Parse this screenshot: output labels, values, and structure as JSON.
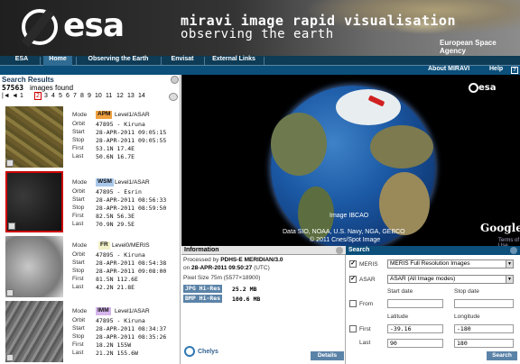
{
  "header": {
    "logo_text": "esa",
    "app_title": "miravi image rapid visualisation",
    "app_subtitle": "observing the earth",
    "agency": "European Space Agency"
  },
  "nav": {
    "items": [
      {
        "label": "ESA"
      },
      {
        "label": "Home"
      },
      {
        "label": "Observing the Earth"
      },
      {
        "label": "Envisat"
      },
      {
        "label": "External Links"
      }
    ],
    "active": "Home"
  },
  "subnav": {
    "about": "About MIRAVI",
    "help": "Help",
    "help_icon": "?"
  },
  "results": {
    "title": "Search Results",
    "count": "57563",
    "count_label": "images found",
    "pager": {
      "first": "|◄",
      "prev": "◄",
      "pages": [
        "1",
        "2",
        "3",
        "4",
        "5",
        "6",
        "7",
        "8",
        "9",
        "10",
        "11",
        "12",
        "13",
        "14"
      ],
      "current": "2"
    },
    "items": [
      {
        "mode_label": "Mode",
        "orbit_label": "Orbit",
        "start_label": "Start",
        "stop_label": "Stop",
        "first_label": "First",
        "last_label": "Last",
        "mode": "APM",
        "level": "Level1/ASAR",
        "orbit": "47895 - Kiruna",
        "start": "28-APR-2011 09:05:15",
        "stop": "28-APR-2011 09:05:55",
        "first": "53.1N 17.4E",
        "last": "50.6N 16.7E",
        "badge_color": "#f0a040",
        "thumb": "farm"
      },
      {
        "mode_label": "Mode",
        "orbit_label": "Orbit",
        "start_label": "Start",
        "stop_label": "Stop",
        "first_label": "First",
        "last_label": "Last",
        "mode": "WSM",
        "level": "Level1/ASAR",
        "orbit": "47895 - Esrin",
        "start": "28-APR-2011 08:56:33",
        "stop": "28-APR-2011 08:59:50",
        "first": "82.5N 56.3E",
        "last": "70.9N 29.5E",
        "badge_color": "#a9c8ec",
        "thumb": "dark"
      },
      {
        "mode_label": "Mode",
        "orbit_label": "Orbit",
        "start_label": "Start",
        "stop_label": "Stop",
        "first_label": "First",
        "last_label": "Last",
        "mode": "FR",
        "level": "Level0/MERIS",
        "orbit": "47895 - Kiruna",
        "start": "28-APR-2011 08:54:38",
        "stop": "28-APR-2011 09:08:00",
        "first": "81.5N 112.6E",
        "last": "42.2N 21.8E",
        "badge_color": "#f2f2c8",
        "thumb": "cloud"
      },
      {
        "mode_label": "Mode",
        "orbit_label": "Orbit",
        "start_label": "Start",
        "stop_label": "Stop",
        "first_label": "First",
        "last_label": "Last",
        "mode": "IMM",
        "level": "Level1/ASAR",
        "orbit": "47895 - Kiruna",
        "start": "28-APR-2011 08:34:37",
        "stop": "28-APR-2011 08:35:26",
        "first": "18.2N 155W",
        "last": "21.2N 155.6W",
        "badge_color": "#d6b6ec",
        "thumb": "grey"
      }
    ]
  },
  "globe": {
    "esa_logo": "esa",
    "image_credit": "Image IBCAO",
    "data_credit": "Data SIO, NOAA, U.S. Navy, NGA, GEBCO",
    "copyright": "© 2011 Cnes/Spot Image",
    "google": "Google",
    "terms": "Terms of Use"
  },
  "info": {
    "title": "Information",
    "processed_prefix": "Processed by",
    "processor": "PDHS-E MERIDIAN/3.0",
    "on_prefix": "on",
    "processed_date": "28-APR-2011 09:50:27",
    "processed_suffix": "(UTC)",
    "pixel_size": "Pixel Size 75m (5577×18900)",
    "jpg_label": "JPG Hi-Res",
    "jpg_size": "25.2 MB",
    "bmp_label": "BMP Hi-Res",
    "bmp_size": "100.6 MB",
    "logo": "Chelys",
    "details": "Details"
  },
  "search": {
    "title": "Search",
    "meris_label": "MERIS",
    "meris_value": "MERIS Full Resolution Images",
    "asar_label": "ASAR",
    "asar_value": "ASAR (All Image modes)",
    "start_date_label": "Start date",
    "stop_date_label": "Stop date",
    "from_label": "From",
    "latitude_label": "Latitude",
    "longitude_label": "Longitude",
    "first_label": "First",
    "last_label": "Last",
    "first_lat": "-39.16",
    "first_lon": "-180",
    "last_lat": "90",
    "last_lon": "180",
    "meris_checked": "✓",
    "asar_checked": "✓",
    "button": "Search"
  }
}
